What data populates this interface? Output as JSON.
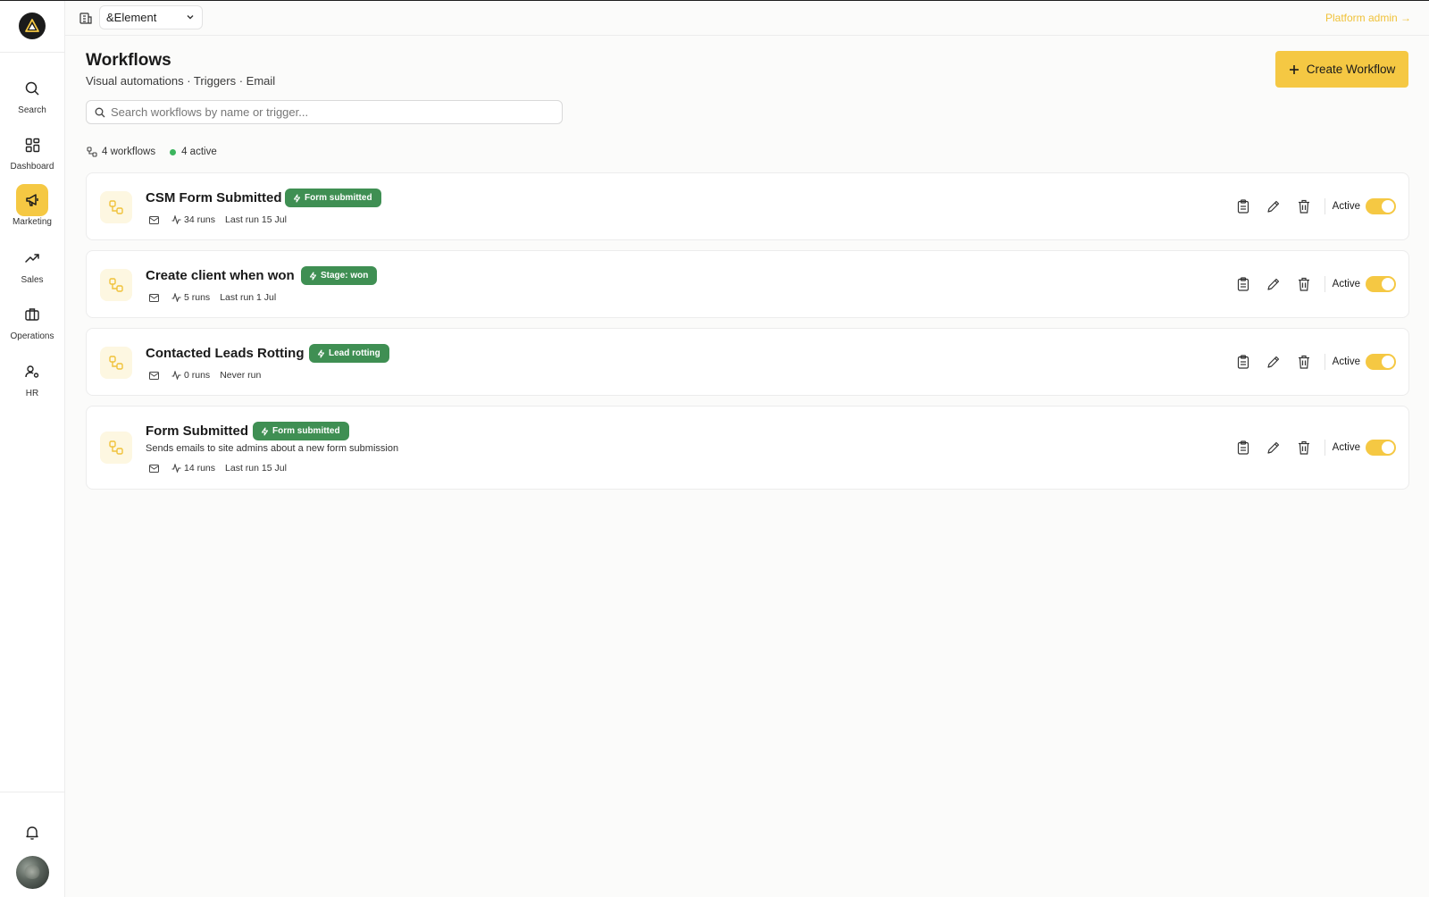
{
  "topbar": {
    "org_name": "&Element",
    "platform_admin": "Platform admin →"
  },
  "sidebar": {
    "items": [
      {
        "label": "Search",
        "icon": "search-icon"
      },
      {
        "label": "Dashboard",
        "icon": "dashboard-icon"
      },
      {
        "label": "Marketing",
        "icon": "megaphone-icon",
        "active": true
      },
      {
        "label": "Sales",
        "icon": "trending-up-icon"
      },
      {
        "label": "Operations",
        "icon": "briefcase-icon"
      },
      {
        "label": "HR",
        "icon": "user-settings-icon"
      }
    ]
  },
  "header": {
    "title": "Workflows",
    "subtitle": "Visual automations · Triggers · Email",
    "create_label": "Create Workflow"
  },
  "search": {
    "placeholder": "Search workflows by name or trigger..."
  },
  "stats": {
    "workflows": "4 workflows",
    "active": "4 active"
  },
  "workflows": [
    {
      "name": "CSM Form Submitted",
      "trigger": "Form submitted",
      "description": "",
      "runs": "34 runs",
      "last_run": "Last run 15 Jul",
      "status": "Active"
    },
    {
      "name": "Create client when won",
      "trigger": "Stage: won",
      "description": "",
      "runs": "5 runs",
      "last_run": "Last run 1 Jul",
      "status": "Active"
    },
    {
      "name": "Contacted Leads Rotting",
      "trigger": "Lead rotting",
      "description": "",
      "runs": "0 runs",
      "last_run": "Never run",
      "status": "Active"
    },
    {
      "name": "Form Submitted",
      "trigger": "Form submitted",
      "description": "Sends emails to site admins about a new form submission",
      "runs": "14 runs",
      "last_run": "Last run 15 Jul",
      "status": "Active"
    }
  ],
  "colors": {
    "accent": "#f5c843",
    "badge_green": "#3f8f53",
    "active_dot": "#3cb55e"
  }
}
